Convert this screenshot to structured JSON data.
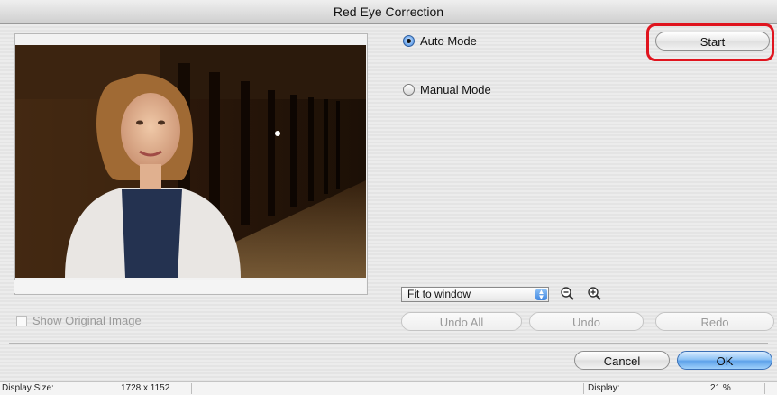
{
  "window": {
    "title": "Red Eye Correction"
  },
  "modes": {
    "auto_label": "Auto Mode",
    "manual_label": "Manual Mode",
    "selected": "auto"
  },
  "buttons": {
    "start": "Start",
    "undo_all": "Undo All",
    "undo": "Undo",
    "redo": "Redo",
    "cancel": "Cancel",
    "ok": "OK"
  },
  "zoom": {
    "selected_option": "Fit to window",
    "zoom_out_icon": "zoom-out-icon",
    "zoom_in_icon": "zoom-in-icon"
  },
  "show_original": {
    "label": "Show Original Image",
    "checked": false
  },
  "status": {
    "display_size_label": "Display Size:",
    "display_size_value": "1728 x 1152",
    "display_label": "Display:",
    "display_value": "21 %"
  },
  "colors": {
    "highlight": "#e0141e",
    "default_button": "#5ea2ea"
  }
}
